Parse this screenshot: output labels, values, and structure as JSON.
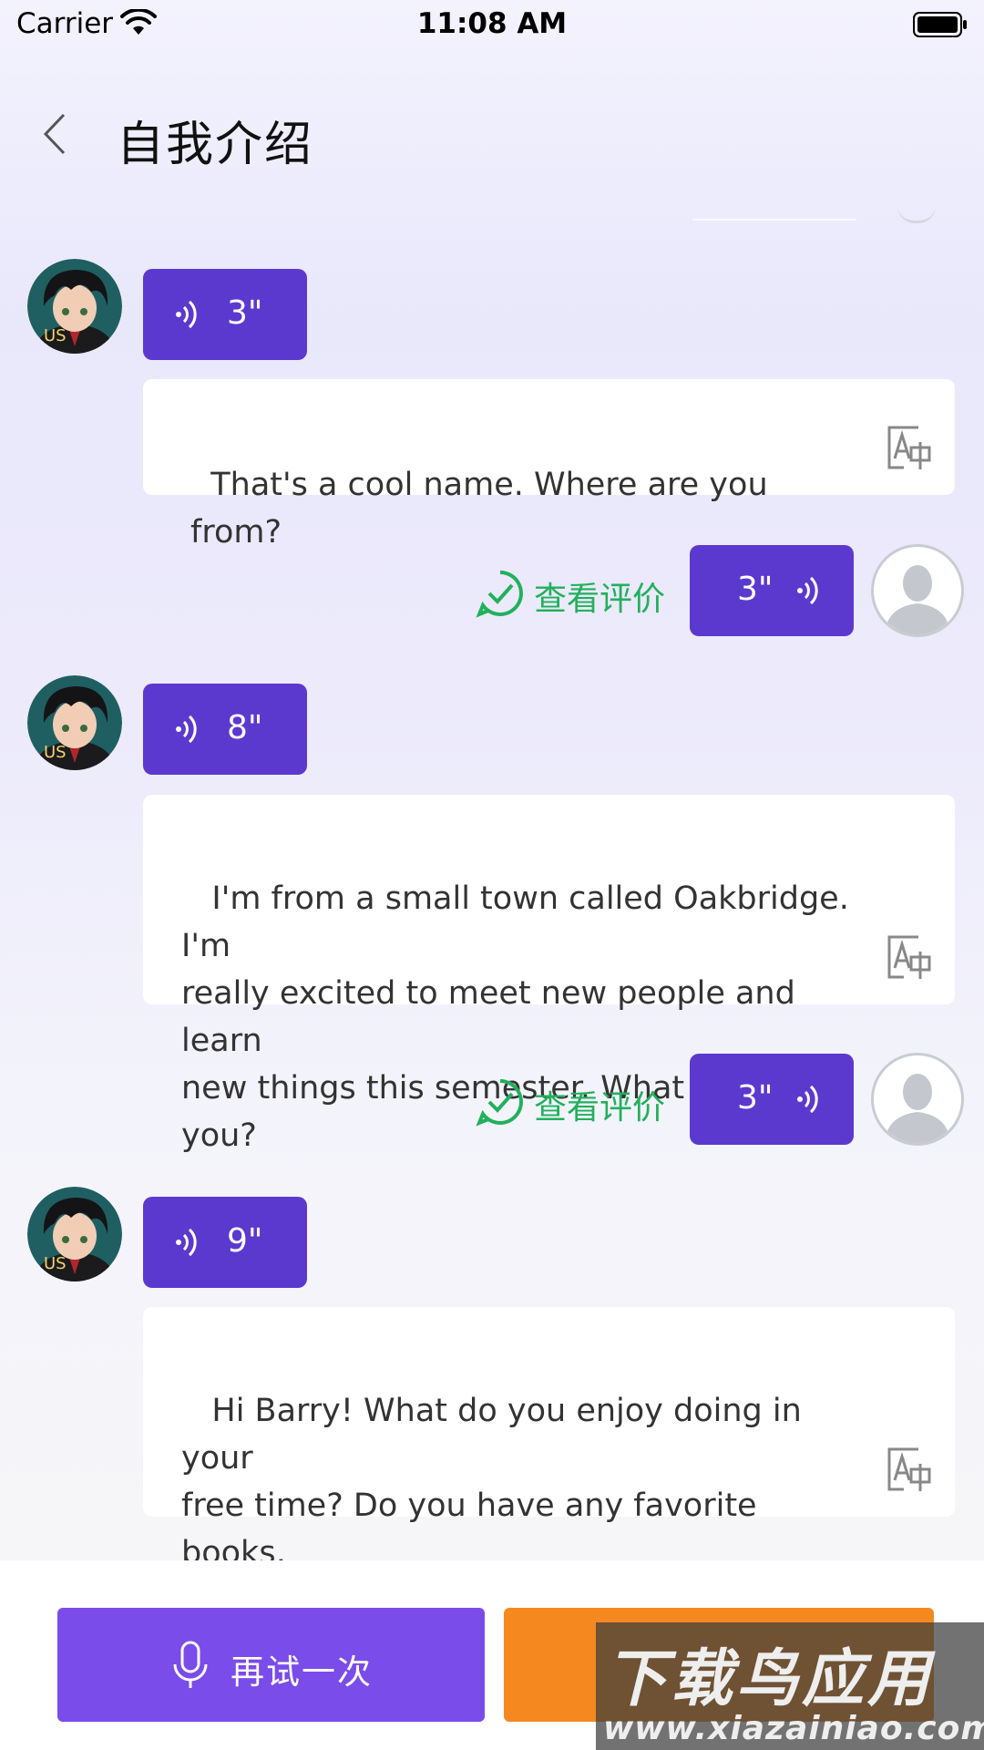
{
  "status_bar": {
    "carrier": "Carrier",
    "time": "11:08 AM"
  },
  "nav": {
    "title": "自我介绍"
  },
  "messages": [
    {
      "role": "bot",
      "avatar_badge": "US",
      "duration": "3\"",
      "text": "That's a cool name. Where are you from?"
    },
    {
      "role": "user",
      "duration": "3\"",
      "eval_label": "查看评价"
    },
    {
      "role": "bot",
      "avatar_badge": "US",
      "duration": "8\"",
      "text": " I'm from a small town called Oakbridge. I'm\nreally excited to meet new people and learn\nnew things this semester. What about you?"
    },
    {
      "role": "user",
      "duration": "3\"",
      "eval_label": "查看评价"
    },
    {
      "role": "bot",
      "avatar_badge": "US",
      "duration": "9\"",
      "text": " Hi Barry! What do you enjoy doing in your\nfree time? Do you have any favorite books,\nmovies, or musicians?"
    }
  ],
  "actions": {
    "retry_label": "再试一次"
  },
  "watermark": {
    "text": "下载鸟应用",
    "url": "www.xiazainiao.com"
  },
  "colors": {
    "voice_bubble": "#5b39cf",
    "retry_button": "#7a4cea",
    "next_button": "#f5891f",
    "eval_green": "#22b05c"
  }
}
